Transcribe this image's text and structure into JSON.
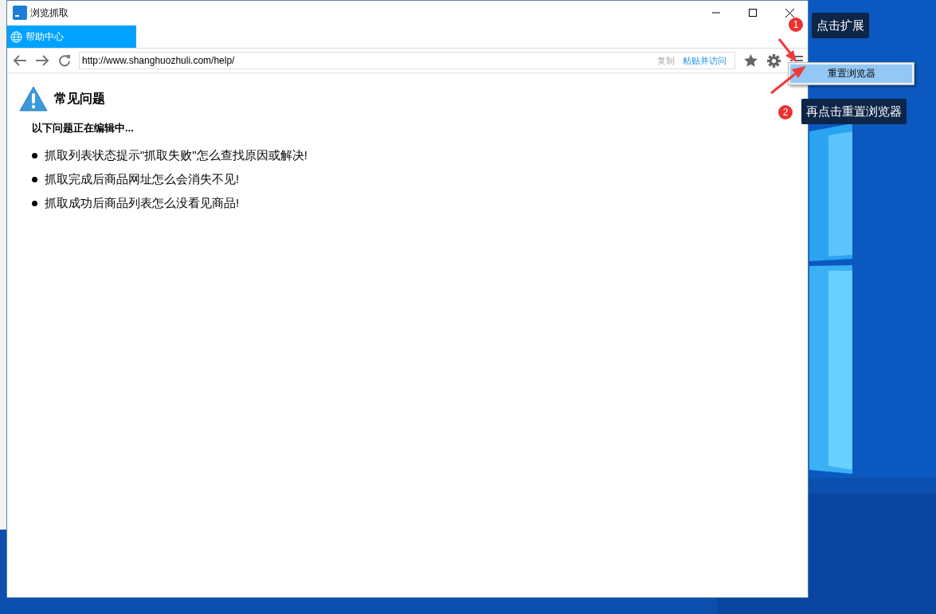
{
  "window": {
    "title": "浏览抓取"
  },
  "tabs": [
    {
      "label": "帮助中心",
      "selected": true
    }
  ],
  "address_bar": {
    "value": "http://www.shanghuozhuli.com/help/",
    "copy_label": "复制",
    "paste_label": "粘贴并访问"
  },
  "menu": {
    "items": [
      {
        "label": "重置浏览器",
        "highlighted": true
      }
    ]
  },
  "content": {
    "heading": "常见问题",
    "note": "以下问题正在编辑中...",
    "questions": [
      "抓取列表状态提示\"抓取失败\"怎么查找原因或解决!",
      "抓取完成后商品网址怎么会消失不见!",
      "抓取成功后商品列表怎么没看见商品!"
    ]
  },
  "annotations": [
    {
      "number": "1",
      "text": "点击扩展"
    },
    {
      "number": "2",
      "text": "再点击重置浏览器"
    }
  ]
}
